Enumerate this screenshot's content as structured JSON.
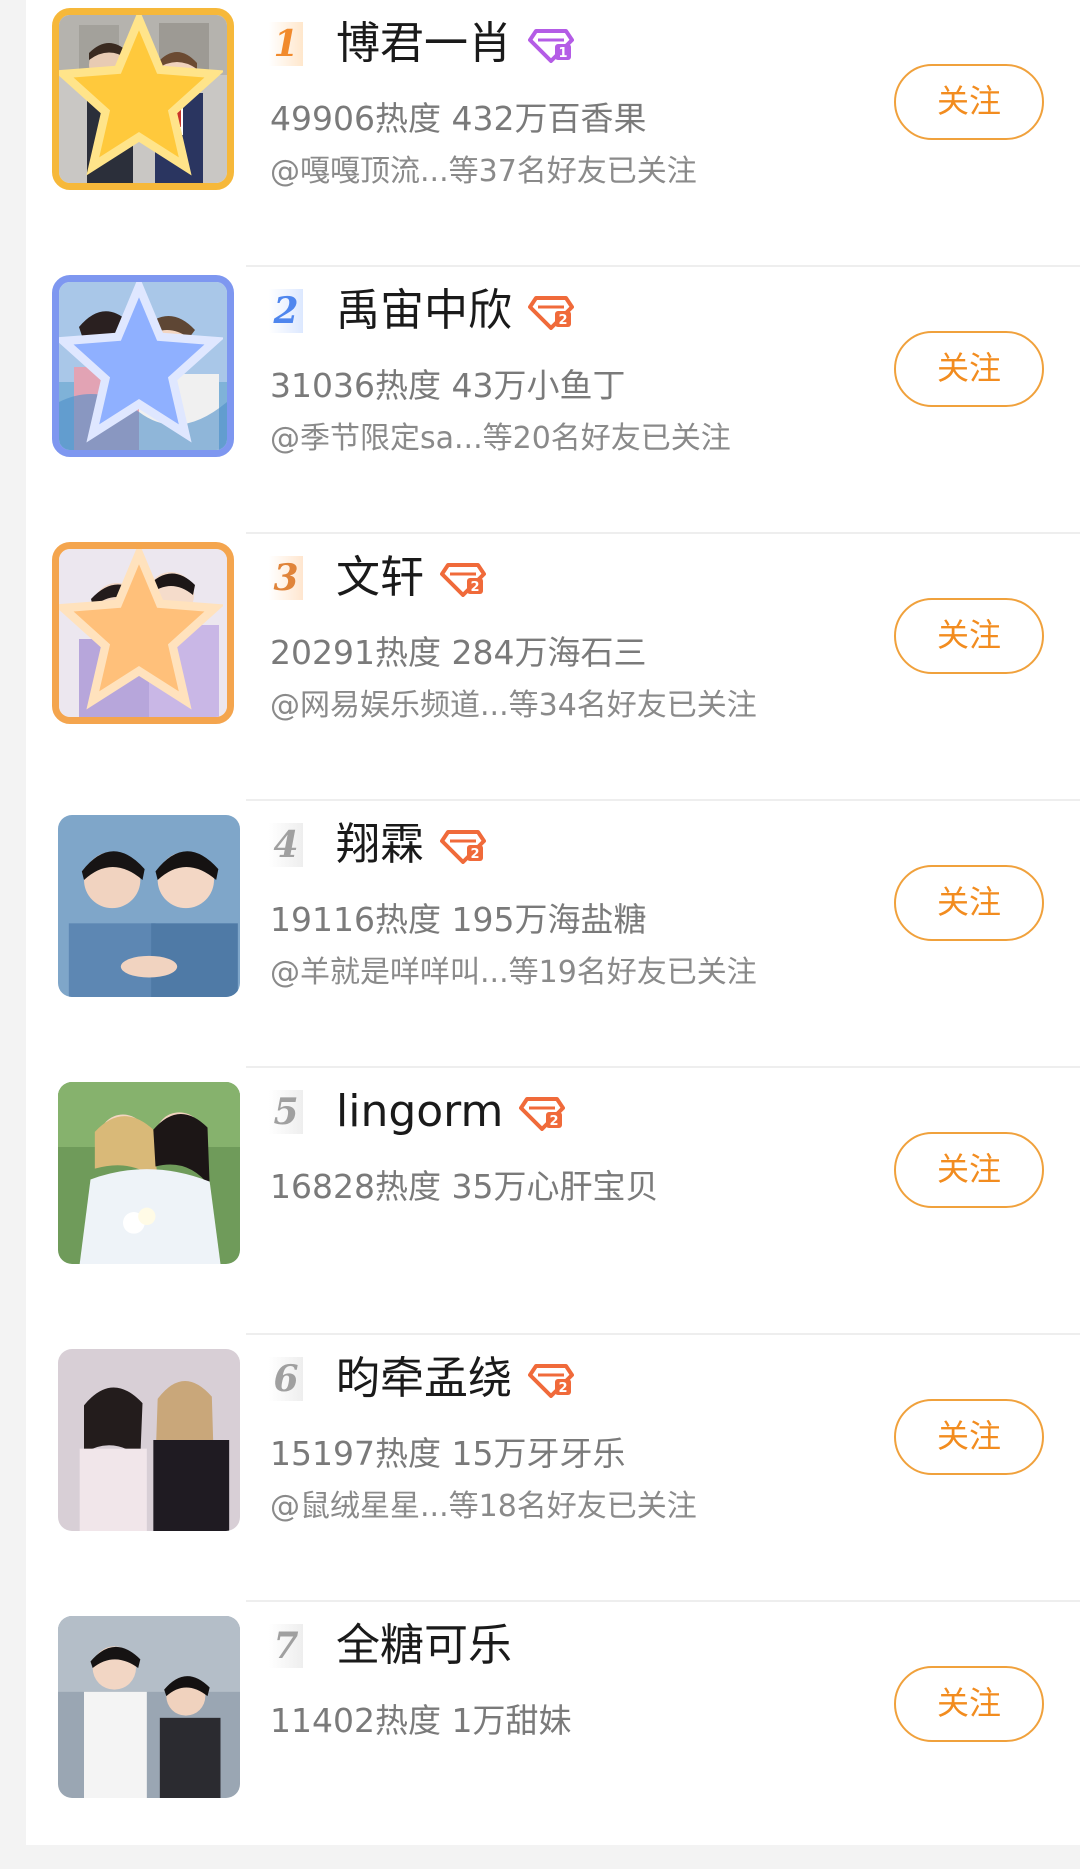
{
  "list": [
    {
      "rank": "1",
      "name": "博君一肖",
      "vip_icon": "diamond-level-1-icon",
      "vip_color": "#b45ce6",
      "stats": "49906热度 432万百香果",
      "friends": "@嘎嘎顶流...等37名好友已关注",
      "follow_label": "关注"
    },
    {
      "rank": "2",
      "name": "禹宙中欣",
      "vip_icon": "diamond-level-2-icon",
      "vip_color": "#f06a3a",
      "stats": "31036热度 43万小鱼丁",
      "friends": "@季节限定sa...等20名好友已关注",
      "follow_label": "关注"
    },
    {
      "rank": "3",
      "name": "文轩",
      "vip_icon": "diamond-level-2-icon",
      "vip_color": "#f06a3a",
      "stats": "20291热度 284万海石三",
      "friends": "@网易娱乐频道...等34名好友已关注",
      "follow_label": "关注"
    },
    {
      "rank": "4",
      "name": "翔霖",
      "vip_icon": "diamond-level-2-icon",
      "vip_color": "#f06a3a",
      "stats": "19116热度 195万海盐糖",
      "friends": "@羊就是咩咩叫...等19名好友已关注",
      "follow_label": "关注"
    },
    {
      "rank": "5",
      "name": "lingorm",
      "vip_icon": "diamond-level-2-icon",
      "vip_color": "#f06a3a",
      "stats": "16828热度 35万心肝宝贝",
      "friends": "",
      "follow_label": "关注"
    },
    {
      "rank": "6",
      "name": "昀牵孟绕",
      "vip_icon": "diamond-level-2-icon",
      "vip_color": "#f06a3a",
      "stats": "15197热度 15万牙牙乐",
      "friends": "@鼠绒星星...等18名好友已关注",
      "follow_label": "关注"
    },
    {
      "rank": "7",
      "name": "全糖可乐",
      "vip_icon": "",
      "vip_color": "",
      "stats": "11402热度 1万甜妹",
      "friends": "",
      "follow_label": "关注"
    }
  ],
  "colors": {
    "accent": "#f28c1f",
    "rank1": "#f18a2c",
    "rank2": "#4f86ee",
    "rank3": "#e0843a",
    "rank_default": "#a0a0a0"
  }
}
